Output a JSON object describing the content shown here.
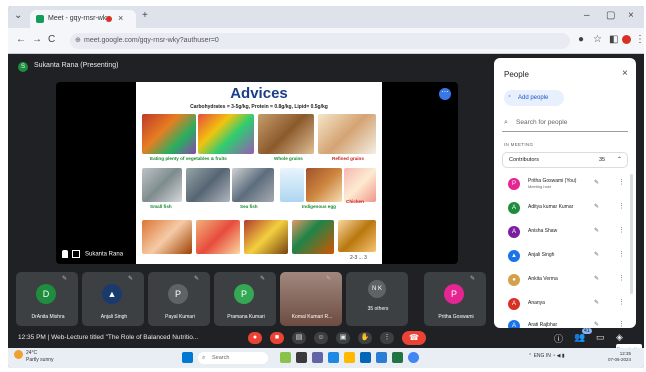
{
  "browser": {
    "tab_title": "Meet - gqy-rnsr-wky",
    "url": "meet.google.com/gqy-rnsr-wky?authuser=0",
    "nav": {
      "back": "←",
      "forward": "→",
      "reload": "C"
    }
  },
  "meet": {
    "presenter_initial": "S",
    "presenting_label": "Sukanta Rana (Presenting)",
    "stage_footer_name": "Sukanta Rana",
    "slide": {
      "title": "Advices",
      "subtitle": "Carbohydrates = 3-5g/kg, Protein = 0.8g/kg, Lipid= 0.5g/kg",
      "captions": [
        {
          "text": "Eating plenty of vegetables & fruits",
          "color": "green"
        },
        {
          "text": "Whole grains",
          "color": "green"
        },
        {
          "text": "Refined grains",
          "color": "red"
        },
        {
          "text": "Small fish",
          "color": "green"
        },
        {
          "text": "Sea fish",
          "color": "green"
        },
        {
          "text": "Indigenous egg",
          "color": "green"
        },
        {
          "text": "Chicken",
          "color": "red"
        }
      ],
      "more": "2-3 ... 3"
    },
    "tiles": [
      {
        "initial": "D",
        "name": "DrAnita Mishra",
        "color": "#1e8e3e"
      },
      {
        "initial": "",
        "name": "Anjali Singh",
        "color": "#1a73e8"
      },
      {
        "initial": "P",
        "name": "Payal Kumari",
        "color": "#5f6368"
      },
      {
        "initial": "P",
        "name": "Pramana Kumari",
        "color": "#34a853"
      },
      {
        "initial": "",
        "name": "Komal Kumari R...",
        "color": "#8d6e63"
      },
      {
        "initial": "N K",
        "name": "35 others",
        "color": "#5f6368"
      },
      {
        "initial": "P",
        "name": "Pritha Goswami",
        "color": "#e52592"
      }
    ],
    "bottom_bar": {
      "time": "12:35 PM",
      "meeting_title": "Web-Lecture titled \"The Role of Balanced Nutritio...",
      "tooltip": "Show desktop",
      "people_count": "41"
    }
  },
  "people_panel": {
    "title": "People",
    "add_people": "Add people",
    "search_placeholder": "Search for people",
    "in_meeting": "IN MEETING",
    "contributors_label": "Contributors",
    "contributors_count": "35",
    "people": [
      {
        "initial": "P",
        "name": "Pritha Goswami (You)",
        "sub": "Meeting host",
        "color": "#e52592"
      },
      {
        "initial": "A",
        "name": "Aditya kumar Kumar",
        "sub": "",
        "color": "#1e8e3e"
      },
      {
        "initial": "A",
        "name": "Anisha Shaw",
        "sub": "",
        "color": "#7b1fa2"
      },
      {
        "initial": "",
        "name": "Anjali Singh",
        "sub": "",
        "color": "#1a73e8"
      },
      {
        "initial": "",
        "name": "Ankita Verma",
        "sub": "",
        "color": "#d4a04c"
      },
      {
        "initial": "A",
        "name": "Ananya",
        "sub": "",
        "color": "#d93025"
      },
      {
        "initial": "A",
        "name": "Arati Rajbhar",
        "sub": "",
        "color": "#1a73e8"
      }
    ]
  },
  "taskbar": {
    "weather_temp": "24°C",
    "weather_desc": "Partly sunny",
    "search_label": "Search",
    "lang": "ENG IN",
    "time": "12:35",
    "date": "07-06-2024"
  },
  "colors": {
    "meet_bg": "#202124",
    "tile_bg": "#3c4043",
    "accent_blue": "#1a73e8",
    "leave_red": "#ea4335",
    "slide_title": "#1b3d8a"
  }
}
